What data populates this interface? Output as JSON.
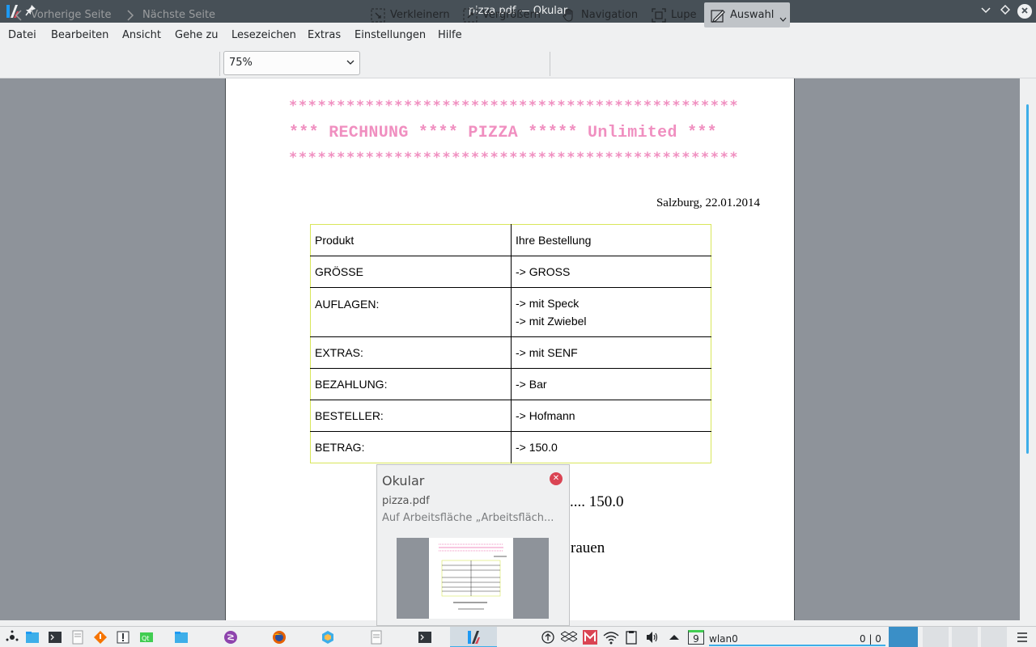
{
  "window": {
    "title": "pizza.pdf — Okular"
  },
  "menubar": {
    "items": [
      "Datei",
      "Bearbeiten",
      "Ansicht",
      "Gehe zu",
      "Lesezeichen",
      "Extras",
      "Einstellungen",
      "Hilfe"
    ]
  },
  "toolbar": {
    "prev_page": "Vorherige Seite",
    "next_page": "Nächste Seite",
    "zoom_value": "75%",
    "zoom_out": "Verkleinern",
    "zoom_in": "Vergrößern",
    "navigation": "Navigation",
    "magnifier": "Lupe",
    "selection": "Auswahl"
  },
  "document": {
    "stars_line": "***********************************************",
    "heading": "*** RECHNUNG **** PIZZA ***** Unlimited ***",
    "date": "Salzburg, 22.01.2014",
    "table": [
      {
        "label": "Produkt",
        "value": [
          "Ihre Bestellung"
        ]
      },
      {
        "label": "GRÖSSE",
        "value": [
          "-> GROSS"
        ]
      },
      {
        "label": "AUFLAGEN:",
        "value": [
          "-> mit Speck",
          "-> mit Zwiebel"
        ]
      },
      {
        "label": "EXTRAS:",
        "value": [
          "-> mit SENF"
        ]
      },
      {
        "label": "BEZAHLUNG:",
        "value": [
          "-> Bar"
        ]
      },
      {
        "label": "BESTELLER:",
        "value": [
          "-> Hofmann"
        ]
      },
      {
        "label": "BETRAG:",
        "value": [
          "-> 150.0"
        ]
      }
    ],
    "partial_total": ".... 150.0",
    "partial_text": "rauen"
  },
  "tooltip": {
    "app": "Okular",
    "file": "pizza.pdf",
    "desktop": "Auf Arbeitsfläche „Arbeitsfläch..."
  },
  "taskbar": {
    "desktop_number": "9",
    "network_name": "wlan0",
    "network_stats": "0 | 0"
  },
  "colors": {
    "accent": "#3daee9",
    "titlebar": "#475057",
    "pink_text": "#f08fc0",
    "table_border": "#d8e65a",
    "doc_background": "#8e939a"
  }
}
